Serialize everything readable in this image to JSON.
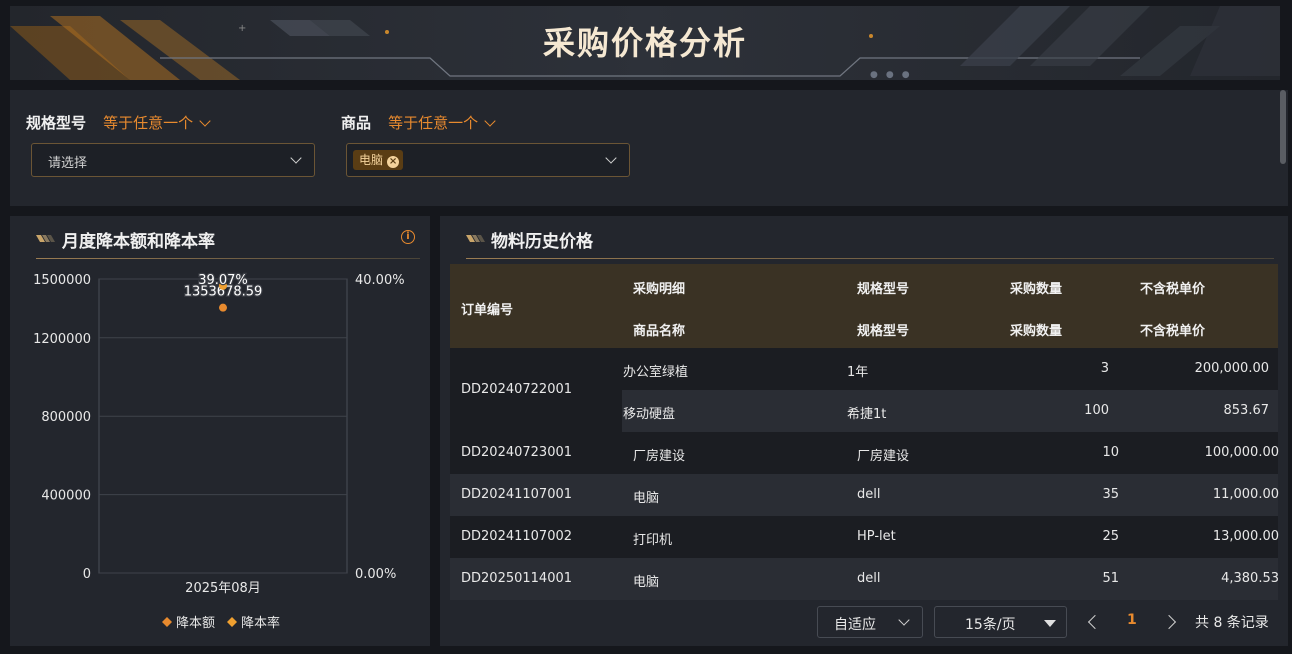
{
  "header": {
    "title": "采购价格分析"
  },
  "filters": [
    {
      "label": "规格型号",
      "operator": "等于任意一个",
      "placeholder": "请选择",
      "selected": []
    },
    {
      "label": "商品",
      "operator": "等于任意一个",
      "placeholder": "",
      "selected": [
        "电脑"
      ]
    }
  ],
  "chart_panel": {
    "title": "月度降本额和降本率",
    "chart_data": {
      "type": "scatter",
      "categories": [
        "2025年08月"
      ],
      "series": [
        {
          "name": "降本额",
          "axis": "left",
          "values": [
            1353678.59
          ],
          "label": "1353678.59",
          "color": "#e88a2e"
        },
        {
          "name": "降本率",
          "axis": "right",
          "values": [
            39.07
          ],
          "label": "39.07%",
          "color": "#f0a030"
        }
      ],
      "y_left": {
        "min": 0,
        "max": 1500000,
        "ticks": [
          "0",
          "400000",
          "800000",
          "1200000",
          "1500000"
        ],
        "tick_values": [
          0,
          400000,
          800000,
          1200000,
          1500000
        ]
      },
      "y_right": {
        "min": 0,
        "max": 40,
        "ticks": [
          "0.00%",
          "40.00%"
        ],
        "tick_values": [
          0,
          40
        ]
      },
      "grid": true,
      "legend_position": "bottom"
    }
  },
  "table_panel": {
    "title": "物料历史价格",
    "header": {
      "order_no": "订单编号",
      "group1": [
        "采购明细",
        "规格型号",
        "采购数量",
        "不含税单价"
      ],
      "group2": [
        "商品名称",
        "规格型号",
        "采购数量",
        "不含税单价"
      ]
    },
    "rows": [
      {
        "order": "DD20240722001",
        "items": [
          {
            "name": "办公室绿植",
            "spec": "1年",
            "qty": "3",
            "price": "200,000.00"
          },
          {
            "name": "移动硬盘",
            "spec": "希捷1t",
            "qty": "100",
            "price": "853.67"
          }
        ]
      },
      {
        "order": "DD20240723001",
        "items": [
          {
            "name": "厂房建设",
            "spec": "厂房建设",
            "qty": "10",
            "price": "100,000.00"
          }
        ]
      },
      {
        "order": "DD20241107001",
        "items": [
          {
            "name": "电脑",
            "spec": "dell",
            "qty": "35",
            "price": "11,000.00"
          }
        ]
      },
      {
        "order": "DD20241107002",
        "items": [
          {
            "name": "打印机",
            "spec": "HP-let",
            "qty": "25",
            "price": "13,000.00"
          }
        ]
      },
      {
        "order": "DD20250114001",
        "items": [
          {
            "name": "电脑",
            "spec": "dell",
            "qty": "51",
            "price": "4,380.53"
          }
        ]
      }
    ],
    "pagination": {
      "fit": "自适应",
      "page_size": "15条/页",
      "current_page": "1",
      "total": "共 8 条记录"
    }
  }
}
